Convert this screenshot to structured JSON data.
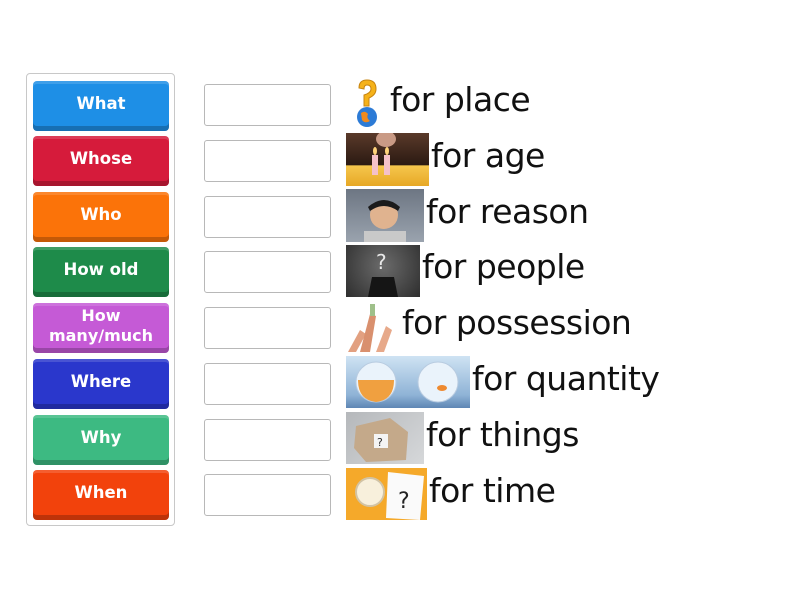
{
  "activity": {
    "tiles": [
      {
        "label": "What",
        "color": "#1e8fe6"
      },
      {
        "label": "Whose",
        "color": "#d61b3b"
      },
      {
        "label": "Who",
        "color": "#fb7309"
      },
      {
        "label": "How old",
        "color": "#1e8b4a"
      },
      {
        "label": "How many/much",
        "color": "#c55ad6"
      },
      {
        "label": "Where",
        "color": "#2a37cc"
      },
      {
        "label": "Why",
        "color": "#3dba82"
      },
      {
        "label": "When",
        "color": "#f2420c"
      }
    ],
    "targets": [
      {
        "image": "question-globe-image",
        "text": "for place"
      },
      {
        "image": "birthday-candles-image",
        "text": "for age"
      },
      {
        "image": "confused-man-image",
        "text": "for reason"
      },
      {
        "image": "question-head-man-image",
        "text": "for people"
      },
      {
        "image": "reaching-hands-image",
        "text": "for possession"
      },
      {
        "image": "fish-bowls-image",
        "text": "for quantity"
      },
      {
        "image": "mystery-box-image",
        "text": "for things"
      },
      {
        "image": "alarm-clock-notebook-image",
        "text": "for time"
      }
    ]
  }
}
